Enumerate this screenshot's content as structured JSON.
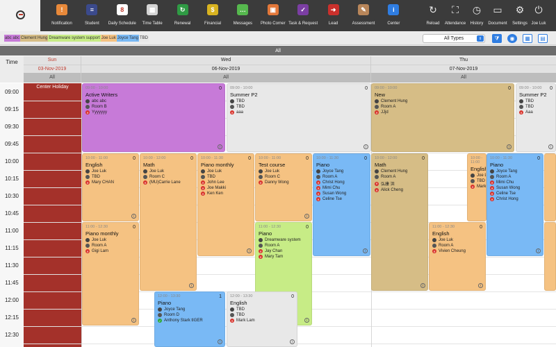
{
  "toolbar": {
    "items": [
      {
        "label": "Notification",
        "icon": "bell-icon",
        "color": "#e8893a",
        "glyph": "!"
      },
      {
        "label": "Student",
        "icon": "student-card-icon",
        "color": "#3b4a8c",
        "glyph": "≡"
      },
      {
        "label": "Daily Schedule",
        "icon": "calendar-icon",
        "color": "#ffffff",
        "glyph": "8"
      },
      {
        "label": "Time Table",
        "icon": "timetable-icon",
        "color": "#d4d4d4",
        "glyph": "▦"
      },
      {
        "label": "Renewal",
        "icon": "renewal-icon",
        "color": "#2f9a44",
        "glyph": "↻"
      },
      {
        "label": "Financial",
        "icon": "dollar-icon",
        "color": "#d8b320",
        "glyph": "$"
      },
      {
        "label": "Messages",
        "icon": "message-icon",
        "color": "#56b84e",
        "glyph": "…"
      },
      {
        "label": "Photo Corner",
        "icon": "photo-icon",
        "color": "#e3783a",
        "glyph": "▣"
      },
      {
        "label": "Task & Request",
        "icon": "task-check-icon",
        "color": "#7b3ea3",
        "glyph": "✓"
      },
      {
        "label": "Lead",
        "icon": "lead-icon",
        "color": "#c9302c",
        "glyph": "➜"
      },
      {
        "label": "Assessment",
        "icon": "pencil-icon",
        "color": "#b8865a",
        "glyph": "✎"
      },
      {
        "label": "Center",
        "icon": "info-icon",
        "color": "#2f7de1",
        "glyph": "i"
      }
    ],
    "right_items": [
      {
        "label": "Reload",
        "icon": "reload-icon",
        "glyph": "↻"
      },
      {
        "label": "Attendance",
        "icon": "scan-icon",
        "glyph": "⛶"
      },
      {
        "label": "History",
        "icon": "history-icon",
        "glyph": "◷"
      },
      {
        "label": "Document",
        "icon": "folder-icon",
        "glyph": "▭"
      },
      {
        "label": "Settings",
        "icon": "gear-icon",
        "glyph": "⚙"
      },
      {
        "label": "Joe Luk",
        "icon": "power-icon",
        "glyph": "⏻"
      }
    ]
  },
  "filters": {
    "chips": [
      {
        "label": "abc abc",
        "color": "#c77ad8"
      },
      {
        "label": "Clement Hung",
        "color": "#d6bd86"
      },
      {
        "label": "Dreamware system support",
        "color": "#c7ec86"
      },
      {
        "label": "Joe Luk",
        "color": "#f5c282"
      },
      {
        "label": "Joyce Tang",
        "color": "#79b9f5"
      },
      {
        "label": "TBD",
        "color": "#e8e8e8"
      }
    ],
    "type_select": "All Types"
  },
  "all_label": "All",
  "time_header": "Time",
  "columns": [
    {
      "day": "Sun",
      "date": "03-Nov-2019",
      "sub": "All"
    },
    {
      "day": "Wed",
      "date": "06-Nov-2019",
      "sub": "All"
    },
    {
      "day": "Thu",
      "date": "07-Nov-2019",
      "sub": "All"
    }
  ],
  "times": [
    "09:00",
    "09:15",
    "09:30",
    "09:45",
    "10:00",
    "10:15",
    "10:30",
    "10:45",
    "11:00",
    "11:15",
    "11:30",
    "11:45",
    "12:00",
    "12:15",
    "12:30"
  ],
  "holiday": "Center Holiday",
  "events": [
    {
      "time": "09:00 - 10:00",
      "count": "0",
      "title": "Active Writers",
      "teacher": "abc abc",
      "room": "Room B",
      "students": [
        {
          "n": "Yyyyyyy",
          "s": "x"
        }
      ],
      "color": "c-purple"
    },
    {
      "time": "09:00 - 10:00",
      "count": "0",
      "title": "Summer P2",
      "teacher": "TBD",
      "room": "TBD",
      "students": [
        {
          "n": "aaa",
          "s": "x"
        }
      ],
      "color": "c-gray"
    },
    {
      "time": "10:00 - 11:00",
      "count": "0",
      "title": "English",
      "teacher": "Joe Luk",
      "room": "TBD",
      "students": [
        {
          "n": "Mary CHAN",
          "s": "x"
        }
      ],
      "color": "c-orange"
    },
    {
      "time": "10:00 - 12:00",
      "count": "0",
      "title": "Math",
      "teacher": "Joe Luk",
      "room": "Room C",
      "students": [
        {
          "n": "(MU)Carrie Lane",
          "s": "x"
        }
      ],
      "color": "c-orange"
    },
    {
      "time": "10:00 - 11:30",
      "count": "0",
      "title": "Piano monthly",
      "teacher": "Joe Luk",
      "room": "TBD",
      "students": [
        {
          "n": "John Lee",
          "s": "x"
        },
        {
          "n": "Joe Makki",
          "s": "x"
        },
        {
          "n": "Ken Ken",
          "s": "x"
        }
      ],
      "color": "c-orange"
    },
    {
      "time": "10:00 - 11:00",
      "count": "0",
      "title": "Test course",
      "teacher": "Joe Luk",
      "room": "Room C",
      "students": [
        {
          "n": "Danny Wong",
          "s": "x"
        }
      ],
      "color": "c-orange"
    },
    {
      "time": "10:00 - 11:30",
      "count": "0",
      "title": "Piano",
      "teacher": "Joyce Tang",
      "room": "Room A",
      "students": [
        {
          "n": "Christ Hong",
          "s": "x"
        },
        {
          "n": "Mimi Chu",
          "s": "x"
        },
        {
          "n": "Susan Wong",
          "s": "x"
        },
        {
          "n": "Celine Tse",
          "s": "x"
        }
      ],
      "color": "c-blue"
    },
    {
      "time": "11:00 - 12:30",
      "count": "0",
      "title": "Piano monthly",
      "teacher": "Joe Luk",
      "room": "Room A",
      "students": [
        {
          "n": "Gigi Lam",
          "s": "x"
        }
      ],
      "color": "c-orange"
    },
    {
      "time": "11:00 - 12:30",
      "count": "0",
      "title": "Piano",
      "teacher": "Dreamware system",
      "room": "Room A",
      "students": [
        {
          "n": "Jay Chan",
          "s": "x"
        },
        {
          "n": "Mary Tam",
          "s": "x"
        }
      ],
      "color": "c-green"
    },
    {
      "time": "12:00 - 13:30",
      "count": "1",
      "title": "Piano",
      "teacher": "Joyce Tang",
      "room": "Room D",
      "students": [
        {
          "n": "Anthony Stark tIGER",
          "s": "ok"
        }
      ],
      "color": "c-blue"
    },
    {
      "time": "12:00 - 13:30",
      "count": "0",
      "title": "English",
      "teacher": "TBD",
      "room": "TBD",
      "students": [
        {
          "n": "Mark Lam",
          "s": "x"
        }
      ],
      "color": "c-gray"
    },
    {
      "time": "09:00 - 10:00",
      "count": "0",
      "title": "New",
      "teacher": "Clement Hung",
      "room": "Room A",
      "students": [
        {
          "n": "JJjd",
          "s": "x"
        }
      ],
      "color": "c-tan"
    },
    {
      "time": "09:00 - 10:00",
      "count": "0",
      "title": "Summer P2",
      "teacher": "TBD",
      "room": "TBD",
      "students": [
        {
          "n": "Aaa",
          "s": "x"
        }
      ],
      "color": "c-gray"
    },
    {
      "time": "10:00 - 12:00",
      "count": "0",
      "title": "Math",
      "teacher": "Clement Hung",
      "room": "Room A",
      "students": [
        {
          "n": "弘康 洪",
          "s": "x"
        },
        {
          "n": "Alick Cheng",
          "s": "x"
        }
      ],
      "color": "c-tan"
    },
    {
      "time": "10:00 - 11:00",
      "count": "",
      "title": "English",
      "teacher": "Joe Luk",
      "room": "TBD",
      "students": [
        {
          "n": "Mark",
          "s": "x"
        }
      ],
      "color": "c-orange"
    },
    {
      "time": "10:00 - 11:30",
      "count": "0",
      "title": "Piano",
      "teacher": "Joyce Tang",
      "room": "Room A",
      "students": [
        {
          "n": "Mimi Chu",
          "s": "x"
        },
        {
          "n": "Susan Wong",
          "s": "x"
        },
        {
          "n": "Celine Tse",
          "s": "x"
        },
        {
          "n": "Christ Hong",
          "s": "x"
        }
      ],
      "color": "c-blue"
    },
    {
      "time": "11:00 - 12:30",
      "count": "0",
      "title": "English",
      "teacher": "Joe Luk",
      "room": "Room A",
      "students": [
        {
          "n": "Vivien Cheung",
          "s": "x"
        }
      ],
      "color": "c-orange"
    },
    {
      "time": "",
      "count": "",
      "title": "",
      "teacher": "",
      "room": "",
      "students": [],
      "color": "c-orange"
    },
    {
      "time": "",
      "count": "",
      "title": "",
      "teacher": "",
      "room": "",
      "students": [],
      "color": "c-orange"
    }
  ]
}
